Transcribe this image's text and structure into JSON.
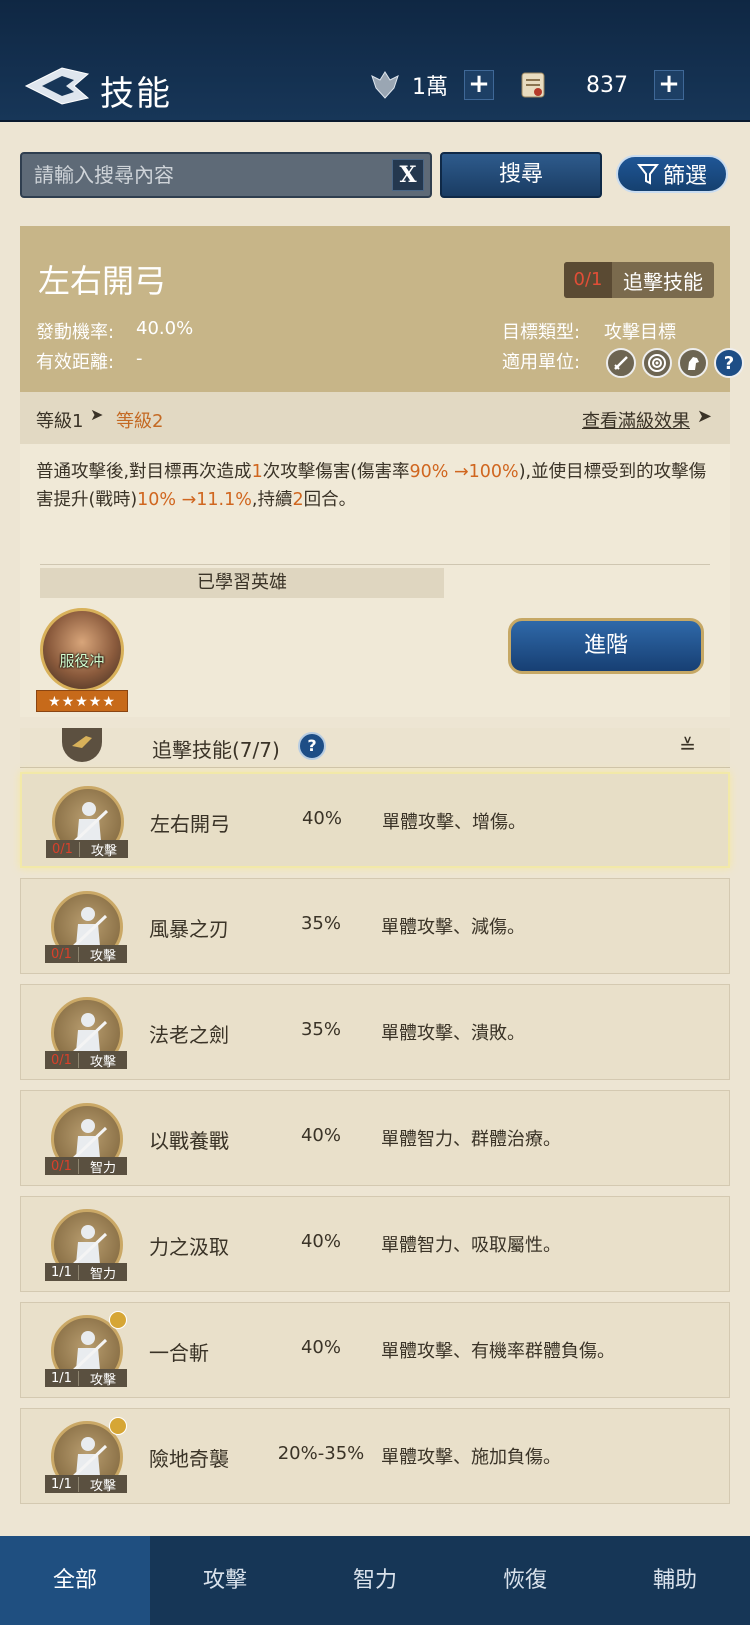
{
  "header": {
    "title": "技能",
    "resources": [
      {
        "icon": "crest-icon",
        "value": "1萬"
      },
      {
        "icon": "scroll-icon",
        "value": "837"
      }
    ]
  },
  "search": {
    "placeholder": "請輸入搜尋內容",
    "clear_label": "X",
    "search_label": "搜尋",
    "filter_label": "篩選"
  },
  "detail": {
    "name": "左右開弓",
    "type_count": "0/1",
    "type_label": "追擊技能",
    "trigger_rate_label": "發動機率:",
    "trigger_rate": "40.0%",
    "range_label": "有效距離:",
    "range": "-",
    "target_label": "目標類型:",
    "target": "攻擊目標",
    "units_label": "適用單位:",
    "unit_icons": [
      "sword-icon",
      "target-icon",
      "horse-icon",
      "help-icon"
    ],
    "level_current": "等級1",
    "level_next": "等級2",
    "full_effect_label": "查看滿級效果",
    "desc_parts": {
      "p1": "普通攻擊後,對目標再次造成",
      "h1": "1",
      "p2": "次攻擊傷害(傷害率",
      "h2": "90% →100%",
      "p3": "),並使目標受到的攻擊傷害提升(戰時)",
      "h3": "10% →11.1%",
      "p4": ",持續",
      "h4": "2",
      "p5": "回合。"
    },
    "learned_label": "已學習英雄",
    "hero": {
      "name": "服役冲",
      "stars": "★★★★★"
    },
    "advance_label": "進階"
  },
  "category": {
    "title": "追擊技能(7/7)",
    "help": "?",
    "collapse": "≚"
  },
  "skills": [
    {
      "name": "左右開弓",
      "rate": "40%",
      "desc": "單體攻擊、增傷。",
      "count": "0/1",
      "type": "攻擊",
      "selected": true
    },
    {
      "name": "風暴之刃",
      "rate": "35%",
      "desc": "單體攻擊、減傷。",
      "count": "0/1",
      "type": "攻擊"
    },
    {
      "name": "法老之劍",
      "rate": "35%",
      "desc": "單體攻擊、潰敗。",
      "count": "0/1",
      "type": "攻擊"
    },
    {
      "name": "以戰養戰",
      "rate": "40%",
      "desc": "單體智力、群體治療。",
      "count": "0/1",
      "type": "智力"
    },
    {
      "name": "力之汲取",
      "rate": "40%",
      "desc": "單體智力、吸取屬性。",
      "count": "1/1",
      "type": "智力"
    },
    {
      "name": "一合斬",
      "rate": "40%",
      "desc": "單體攻擊、有機率群體負傷。",
      "count": "1/1",
      "type": "攻擊"
    },
    {
      "name": "險地奇襲",
      "rate": "20%-35%",
      "desc": "單體攻擊、施加負傷。",
      "count": "1/1",
      "type": "攻擊"
    }
  ],
  "tabs": [
    "全部",
    "攻擊",
    "智力",
    "恢復",
    "輔助"
  ],
  "colors": {
    "header_bg": "#173658",
    "highlight": "#d0661f",
    "accent_blue": "#1e4e86",
    "card_gold": "#c7b588"
  }
}
